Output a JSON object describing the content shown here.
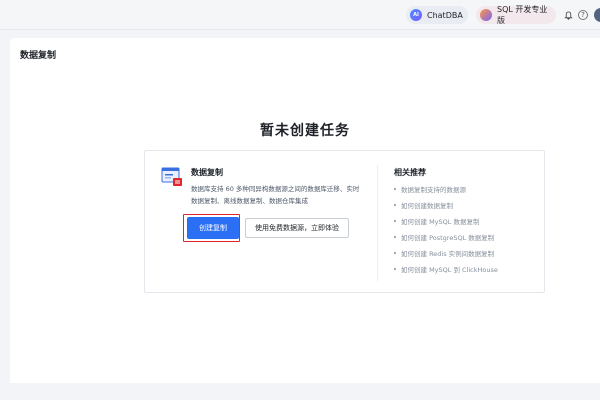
{
  "topbar": {
    "chatdba_label": "ChatDBA",
    "sql_label": "SQL 开发专业版",
    "bell_icon": "bell-icon",
    "help_icon": "help-icon",
    "help_glyph": "?"
  },
  "page": {
    "title": "数据复制"
  },
  "empty_state": {
    "title": "暂未创建任务"
  },
  "card": {
    "heading": "数据复制",
    "description": "数据库支持 60 多种同异构数据源之间的数据库迁移、实时数据复制、离线数据复制、数据仓库集成",
    "primary_button": "创建复制",
    "secondary_button": "使用免费数据源，立即体验",
    "highlight_color": "#e0262a",
    "accent_color": "#2b6ff5"
  },
  "recommendations": {
    "heading": "相关推荐",
    "items": [
      "数据复制支持的数据源",
      "如何创建数据复制",
      "如何创建 MySQL 数据复制",
      "如何创建 PostgreSQL 数据复制",
      "如何创建 Redis 实例间数据复制",
      "如何创建 MySQL 到 ClickHouse"
    ]
  }
}
